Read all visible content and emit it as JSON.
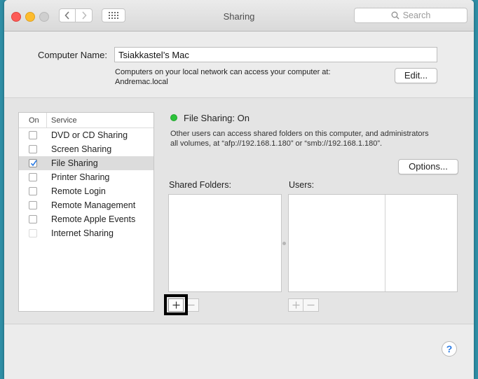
{
  "window": {
    "title": "Sharing"
  },
  "search": {
    "placeholder": "Search"
  },
  "computer_name": {
    "label": "Computer Name:",
    "value": "Tsiakkastel’s Mac",
    "desc_line1": "Computers on your local network can access your computer at:",
    "desc_line2": "Andremac.local",
    "edit_label": "Edit..."
  },
  "service_list": {
    "header_on": "On",
    "header_service": "Service",
    "items": [
      {
        "label": "DVD or CD Sharing",
        "checked": false
      },
      {
        "label": "Screen Sharing",
        "checked": false
      },
      {
        "label": "File Sharing",
        "checked": true,
        "selected": true
      },
      {
        "label": "Printer Sharing",
        "checked": false
      },
      {
        "label": "Remote Login",
        "checked": false
      },
      {
        "label": "Remote Management",
        "checked": false
      },
      {
        "label": "Remote Apple Events",
        "checked": false
      },
      {
        "label": "Internet Sharing",
        "checked": false,
        "disabled": true
      }
    ]
  },
  "status": {
    "text": "File Sharing: On",
    "color": "#2cc33a",
    "desc_line1": "Other users can access shared folders on this computer, and administrators",
    "desc_line2": "all volumes, at “afp://192.168.1.180” or “smb://192.168.1.180”."
  },
  "options_label": "Options...",
  "shared_folders_label": "Shared Folders:",
  "users_label": "Users:",
  "help_label": "?"
}
